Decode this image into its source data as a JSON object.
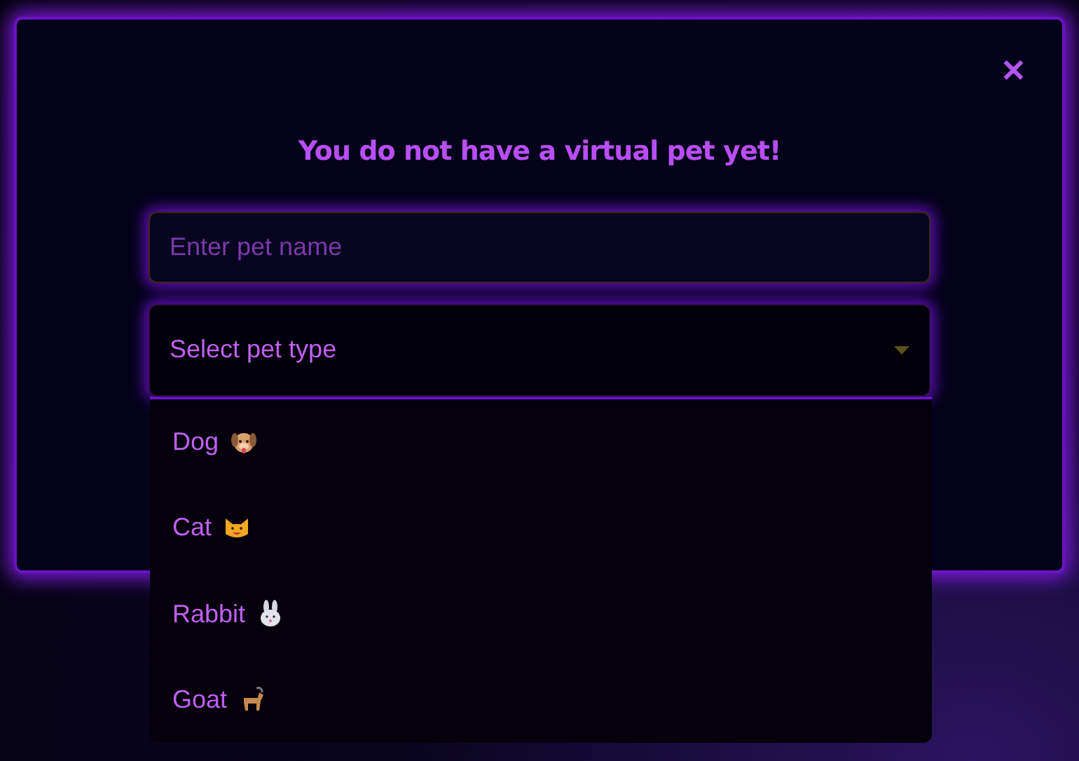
{
  "dialog": {
    "close_label": "✕",
    "title": "You do not have a virtual pet yet!"
  },
  "name_field": {
    "placeholder": "Enter pet name"
  },
  "type_select": {
    "placeholder": "Select pet type",
    "expanded": true
  },
  "options": [
    {
      "label": "Dog",
      "kind": "dog",
      "selected": false
    },
    {
      "label": "Cat",
      "kind": "cat",
      "selected": false
    },
    {
      "label": "Rabbit",
      "kind": "rabbit",
      "selected": false
    },
    {
      "label": "Goat",
      "kind": "goat",
      "selected": false
    }
  ]
}
